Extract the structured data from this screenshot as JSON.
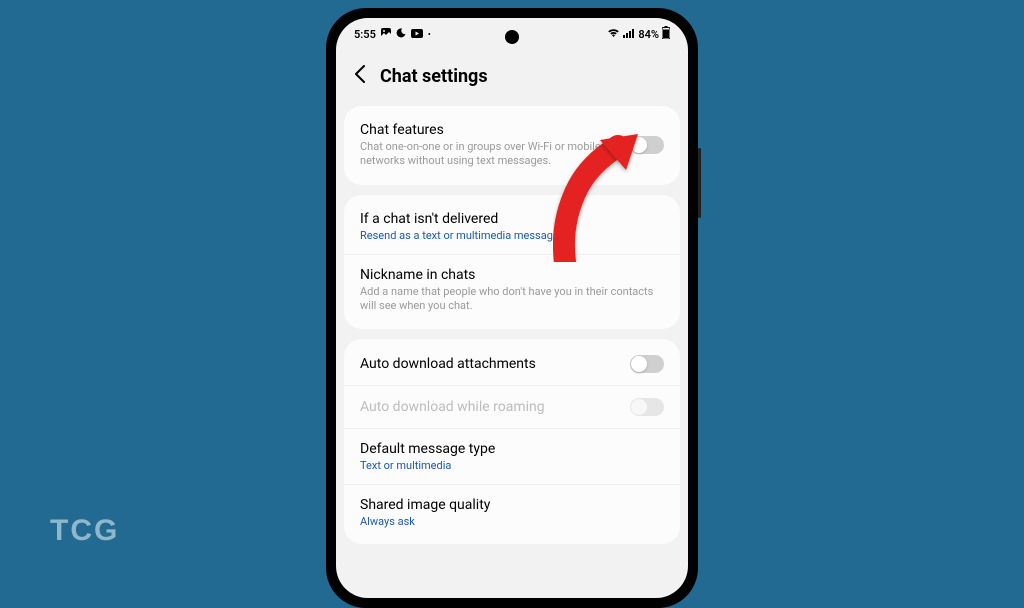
{
  "watermark": "TCG",
  "statusbar": {
    "time": "5:55",
    "battery": "84%"
  },
  "header": {
    "title": "Chat settings"
  },
  "chat_features": {
    "title": "Chat features",
    "desc": "Chat one-on-one or in groups over Wi-Fi or mobile networks without using text messages."
  },
  "not_delivered": {
    "title": "If a chat isn't delivered",
    "value": "Resend as a text or multimedia message"
  },
  "nickname": {
    "title": "Nickname in chats",
    "desc": "Add a name that people who don't have you in their contacts will see when you chat."
  },
  "auto_download": {
    "title": "Auto download attachments"
  },
  "auto_download_roaming": {
    "title": "Auto download while roaming"
  },
  "default_type": {
    "title": "Default message type",
    "value": "Text or multimedia"
  },
  "shared_quality": {
    "title": "Shared image quality",
    "value": "Always ask"
  }
}
